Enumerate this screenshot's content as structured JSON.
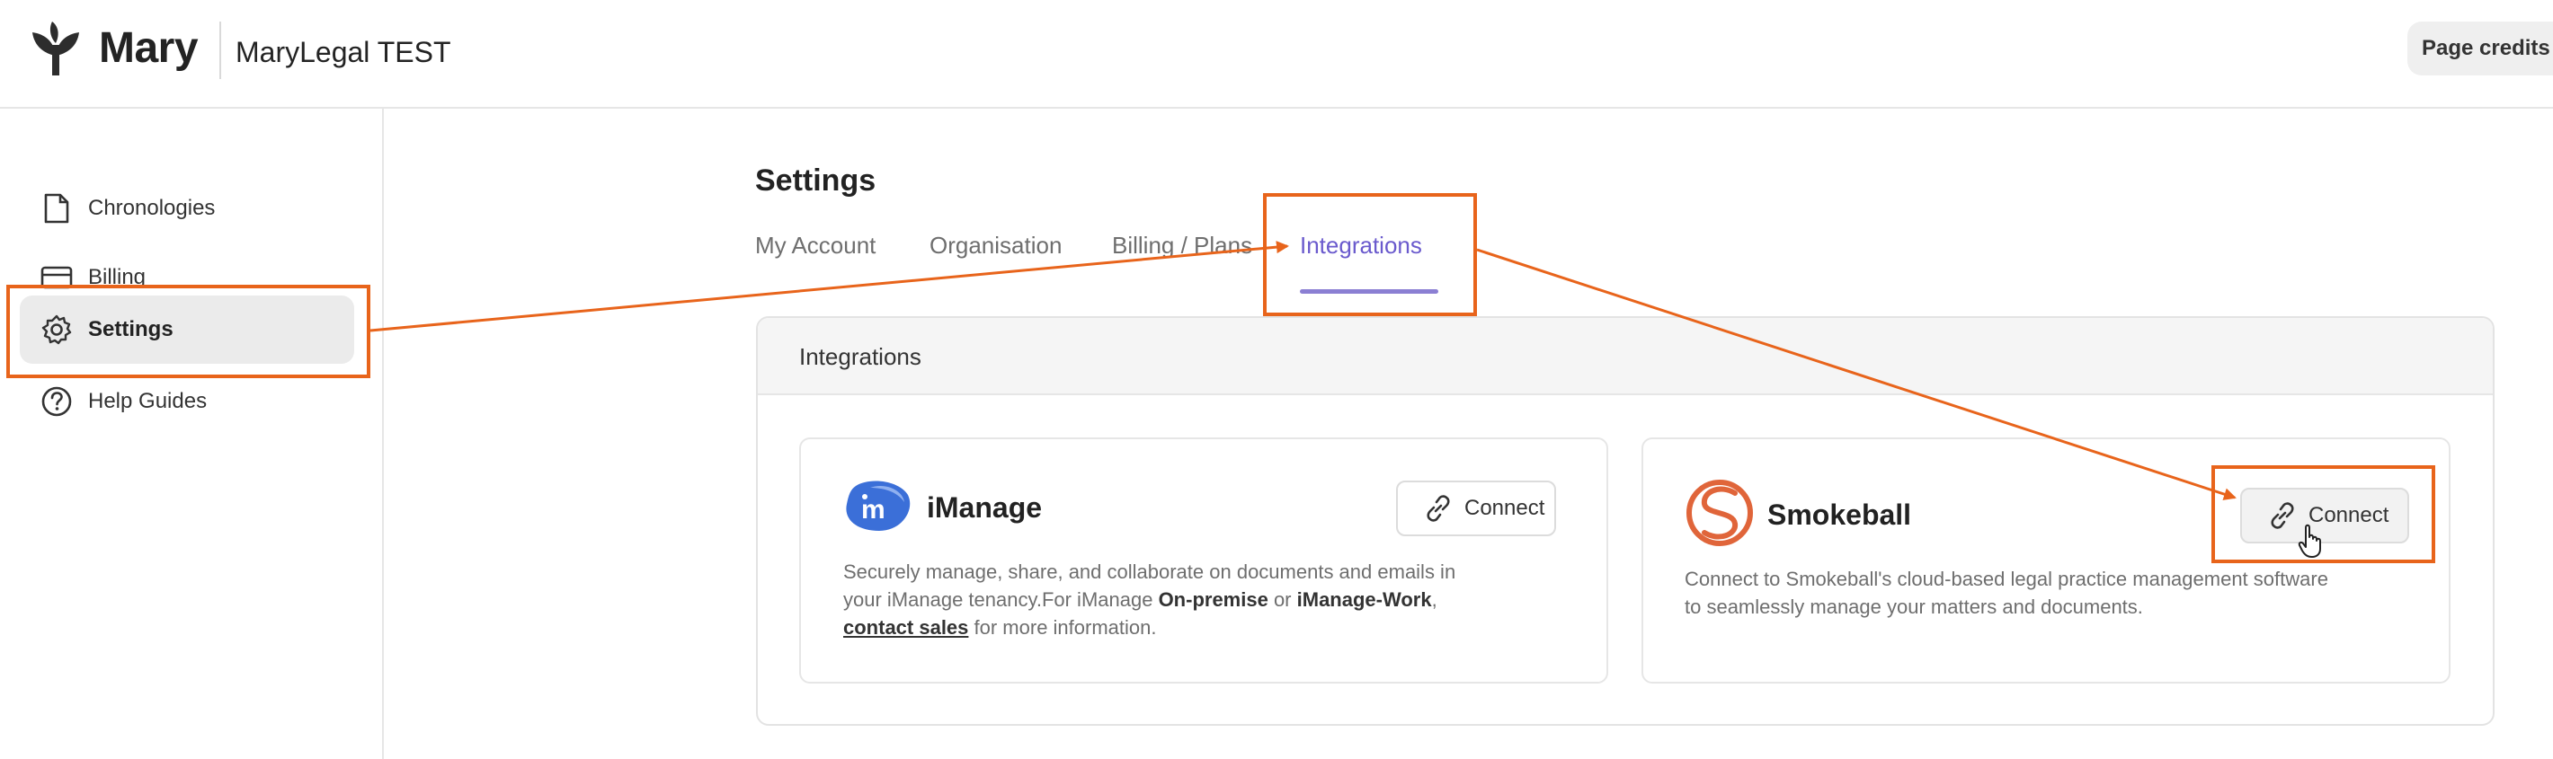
{
  "header": {
    "brand": "Mary",
    "org_name": "MaryLegal TEST",
    "credits_label": "Page credits"
  },
  "sidebar": {
    "items": [
      {
        "label": "Chronologies",
        "icon": "document-icon"
      },
      {
        "label": "Billing",
        "icon": "credit-card-icon"
      },
      {
        "label": "Settings",
        "icon": "gear-icon",
        "active": true
      },
      {
        "label": "Help Guides",
        "icon": "help-circle-icon"
      }
    ]
  },
  "main": {
    "title": "Settings",
    "tabs": [
      {
        "label": "My Account"
      },
      {
        "label": "Organisation"
      },
      {
        "label": "Billing / Plans"
      },
      {
        "label": "Integrations",
        "active": true
      }
    ],
    "panel_title": "Integrations",
    "integrations": [
      {
        "name": "iManage",
        "connect_label": "Connect",
        "desc_1": "Securely manage, share, and collaborate on documents and emails in",
        "desc_2a": "your iManage tenancy.For iManage ",
        "desc_2b": "On-premise",
        "desc_2c": " or ",
        "desc_2d": "iManage-Work",
        "desc_2e": ",",
        "desc_3a": "contact sales",
        "desc_3b": " for more information."
      },
      {
        "name": "Smokeball",
        "connect_label": "Connect",
        "desc_1": "Connect to Smokeball's cloud-based legal practice management software",
        "desc_2": "to seamlessly manage your matters and documents."
      }
    ]
  },
  "colors": {
    "accent": "#6a5acd",
    "annotation": "#e8641b",
    "imanage": "#3b6fd8",
    "smokeball": "#e0653a"
  }
}
